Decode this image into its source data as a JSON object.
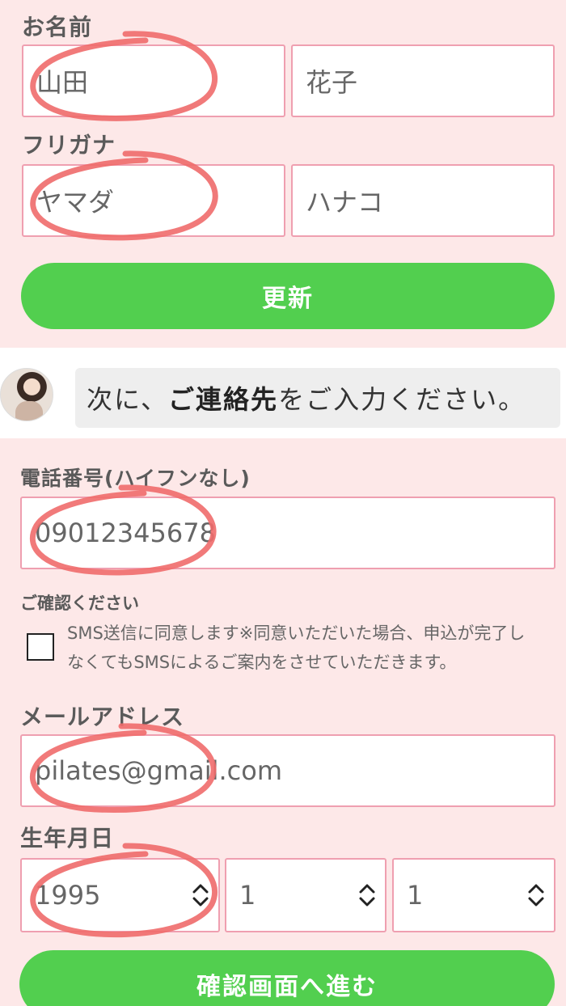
{
  "name_section": {
    "label": "お名前",
    "last_name": "山田",
    "first_name": "花子"
  },
  "furigana_section": {
    "label": "フリガナ",
    "last_name": "ヤマダ",
    "first_name": "ハナコ"
  },
  "update_button": "更新",
  "chat": {
    "message_prefix": "次に、",
    "message_bold": "ご連絡先",
    "message_suffix": "をご入力ください。"
  },
  "phone_section": {
    "label": "電話番号(ハイフンなし)",
    "value": "09012345678"
  },
  "confirm_section": {
    "label": "ご確認ください",
    "consent_text": "SMS送信に同意します※同意いただいた場合、申込が完了しなくてもSMSによるご案内をさせていただきます。"
  },
  "email_section": {
    "label": "メールアドレス",
    "value": "pilates@gmail.com"
  },
  "birth_section": {
    "label": "生年月日",
    "year": "1995",
    "month": "1",
    "day": "1"
  },
  "submit_button": "確認画面へ進む",
  "colors": {
    "accent_green": "#52cf4f",
    "field_border": "#ef9fb0",
    "background_pink": "#fde8e8",
    "annotation_red": "#ef6b6b"
  }
}
